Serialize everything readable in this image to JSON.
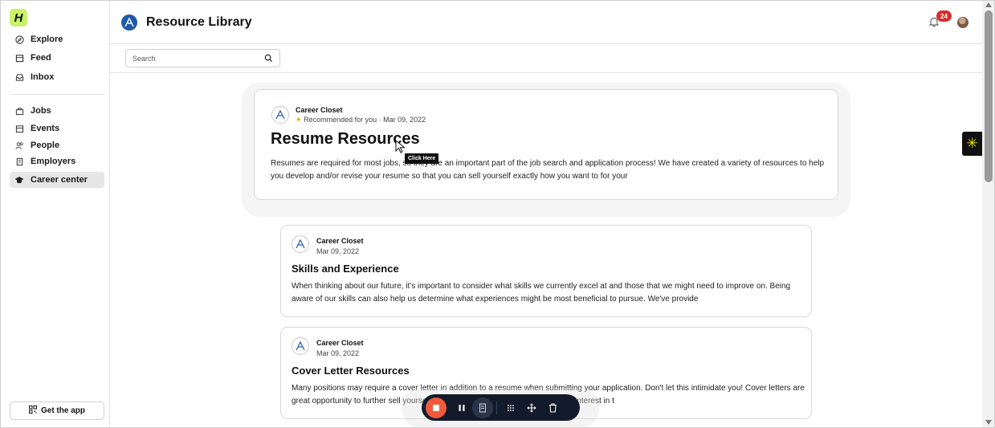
{
  "app": {
    "logo_letter": "H",
    "title": "Resource Library",
    "notification_count": "24",
    "accent_color": "#c8f26a"
  },
  "sidebar": {
    "items": [
      {
        "label": "Explore",
        "icon": "compass-icon"
      },
      {
        "label": "Feed",
        "icon": "feed-icon"
      },
      {
        "label": "Inbox",
        "icon": "inbox-icon"
      },
      {
        "label": "Jobs",
        "icon": "briefcase-icon"
      },
      {
        "label": "Events",
        "icon": "calendar-icon"
      },
      {
        "label": "People",
        "icon": "people-icon"
      },
      {
        "label": "Employers",
        "icon": "building-icon"
      },
      {
        "label": "Career center",
        "icon": "graduation-cap-icon",
        "active": true
      }
    ],
    "get_app_label": "Get the app"
  },
  "search": {
    "placeholder": "Search"
  },
  "featured": {
    "author": "Career Closet",
    "meta": "Recommended for you · Mar 09, 2022",
    "title": "Resume Resources",
    "body": "Resumes are required for most jobs, so they are an important part of the job search and application process! We have created a variety of resources to help you develop and/or revise your resume so that you can sell yourself exactly how you want to for your",
    "tooltip": "Click Here"
  },
  "posts": [
    {
      "author": "Career Closet",
      "date": "Mar 09, 2022",
      "title": "Skills and Experience",
      "body": "When thinking about our future, it's important to consider what skills we currently excel at and those that we might need to improve on. Being aware of our skills can also help us determine what experiences might be most beneficial to pursue. We've provide"
    },
    {
      "author": "Career Closet",
      "date": "Mar 09, 2022",
      "title": "Cover Letter Resources",
      "body": "Many positions may require a cover letter in addition to a resume when submitting your application. Don't let this intimidate you! Cover letters are great opportunity to further sell yourself and help the employer understand your interest in t"
    }
  ],
  "recorder": {
    "buttons": [
      "stop-icon",
      "pause-icon",
      "note-icon",
      "grid-icon",
      "move-icon",
      "trash-icon"
    ],
    "stop_color": "#f05a3a"
  }
}
